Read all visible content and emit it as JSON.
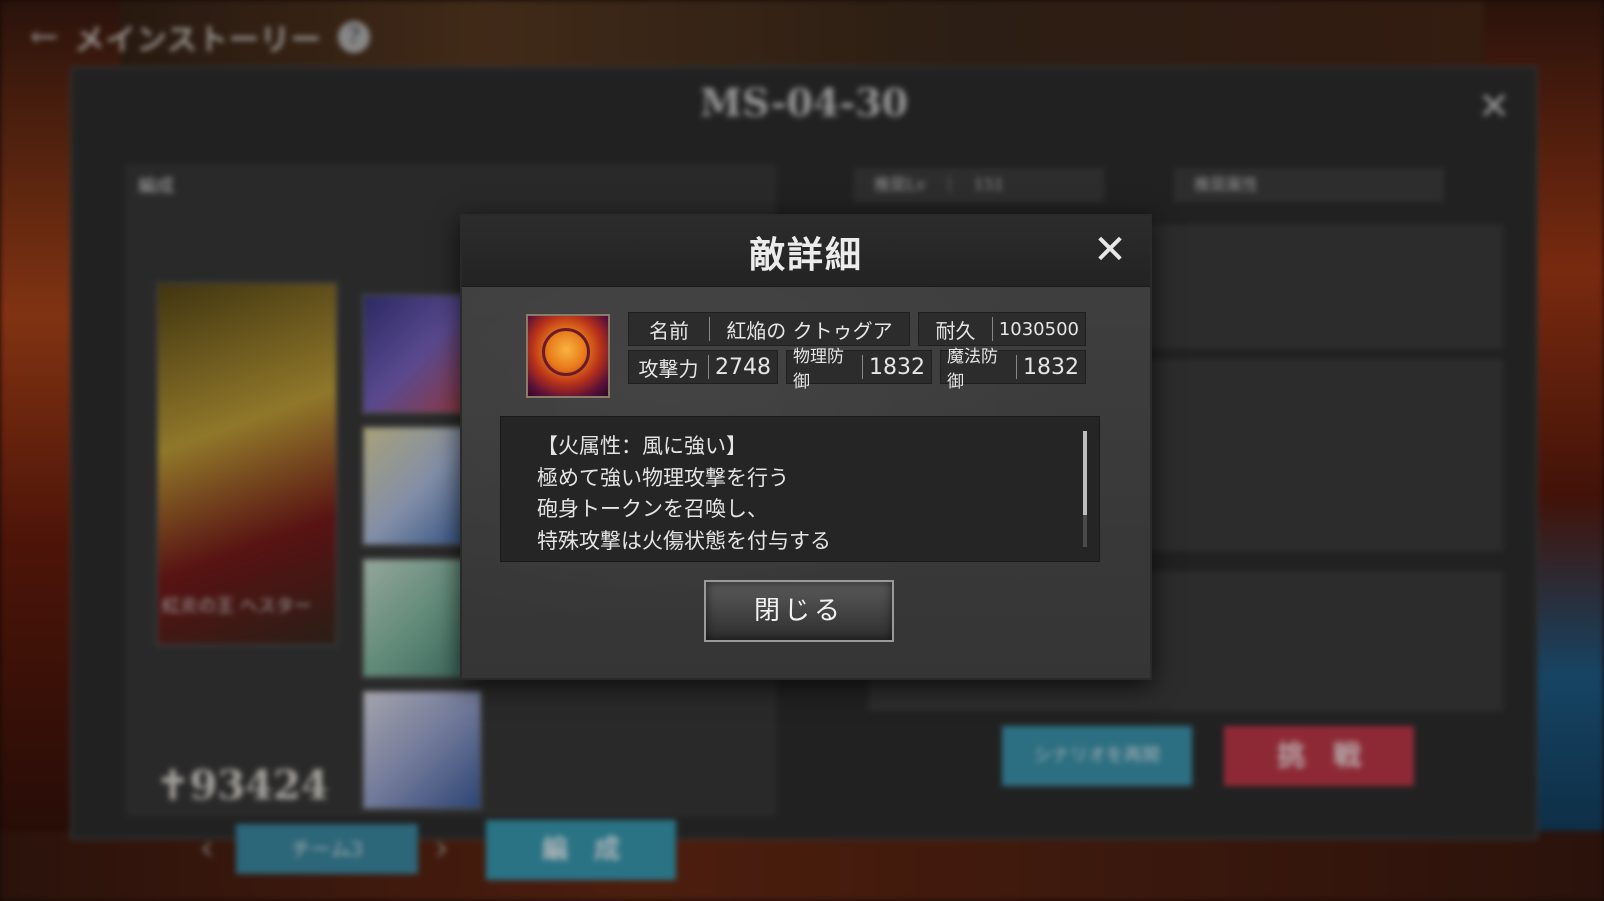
{
  "background": {
    "topbar": {
      "back_icon": "back-arrow-icon",
      "title": "メインストーリー",
      "help_icon": "help-icon"
    },
    "stage_title": "MS-04-30",
    "close_icon": "close-icon",
    "team": {
      "header": "編成",
      "leader_name": "紅炎の王 ヘスター",
      "power": "93424",
      "team_button": "チーム3",
      "edit_button": "編　成"
    },
    "info": {
      "tag_level": "推奨Lv　｜　151",
      "tag_attribute": "推奨属性"
    },
    "retry_button": "シナリオを再開",
    "battle_button": "挑　戦"
  },
  "modal": {
    "title": "敵詳細",
    "close_icon": "close-icon",
    "enemy_icon": "enemy-portrait-icon",
    "stats": {
      "name_label": "名前",
      "name_value": "紅焔の クトゥグア",
      "hp_label": "耐久",
      "hp_value": "1030500",
      "atk_label": "攻撃力",
      "atk_value": "2748",
      "pdef_label": "物理防御",
      "pdef_value": "1832",
      "mdef_label": "魔法防御",
      "mdef_value": "1832"
    },
    "description": [
      "【火属性：風に強い】",
      "極めて強い物理攻撃を行う",
      "砲身トークンを召喚し、",
      "特殊攻撃は火傷状態を付与する"
    ],
    "close_button": "閉じる"
  }
}
